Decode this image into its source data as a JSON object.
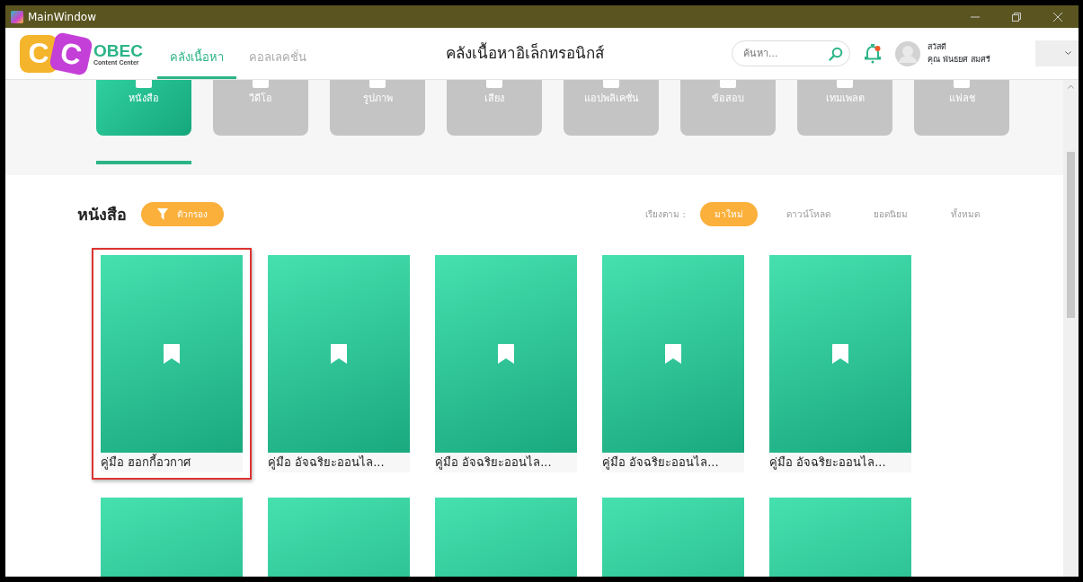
{
  "window": {
    "title": "MainWindow"
  },
  "header": {
    "logo": {
      "letters": [
        "C",
        "C"
      ],
      "name": "OBEC",
      "subtitle": "Content Center"
    },
    "nav": [
      {
        "label": "คลังเนื้อหา",
        "selected": true
      },
      {
        "label": "คอลเลคชั่น",
        "selected": false
      }
    ],
    "page_title": "คลังเนื้อหาอิเล็กทรอนิกส์",
    "search": {
      "placeholder": "ค้นหา..."
    },
    "notification": {
      "unread": true
    },
    "user": {
      "greeting": "สวัสดี",
      "name": "คุณ พันธยศ สมศรี"
    }
  },
  "categories": [
    {
      "label": "หนังสือ",
      "selected": true
    },
    {
      "label": "วีดีโอ",
      "selected": false
    },
    {
      "label": "รูปภาพ",
      "selected": false
    },
    {
      "label": "เสียง",
      "selected": false
    },
    {
      "label": "แอปพลิเคชั่น",
      "selected": false
    },
    {
      "label": "ข้อสอบ",
      "selected": false
    },
    {
      "label": "เทมเพลต",
      "selected": false
    },
    {
      "label": "แฟลช",
      "selected": false
    }
  ],
  "section": {
    "title": "หนังสือ",
    "filter_button": "ตัวกรอง",
    "sort_label": "เรียงตาม :",
    "sort_options": [
      {
        "label": "มาใหม่",
        "selected": true
      },
      {
        "label": "ดาวน์โหลด",
        "selected": false
      },
      {
        "label": "ยอดนิยม",
        "selected": false
      },
      {
        "label": "ทั้งหมด",
        "selected": false
      }
    ]
  },
  "books": [
    {
      "title": "คู่มือ ฮอกกี้อวกาศ",
      "highlighted": true
    },
    {
      "title": "คู่มือ อัจฉริยะออนไล...",
      "highlighted": false
    },
    {
      "title": "คู่มือ อัจฉริยะออนไล...",
      "highlighted": false
    },
    {
      "title": "คู่มือ อัจฉริยะออนไล...",
      "highlighted": false
    },
    {
      "title": "คู่มือ อัจฉริยะออนไล...",
      "highlighted": false
    },
    {
      "highlighted": false
    },
    {
      "highlighted": false
    },
    {
      "highlighted": false
    },
    {
      "highlighted": false
    },
    {
      "highlighted": false
    }
  ]
}
